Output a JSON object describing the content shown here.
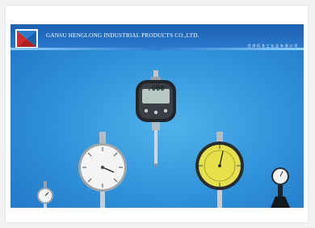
{
  "banner": {
    "company_name": "GANSU HENGLONG INDUSTRIAL PRODUCTS CO.,LTD.",
    "company_name_cn": "甘肃恒龙工业品有限公司"
  },
  "gauges": {
    "digital_reading": ".000"
  },
  "colors": {
    "banner_blue": "#2e8fd8",
    "header_blue": "#1c5fb0",
    "logo_red": "#d62828",
    "dial_yellow": "#e6e04a"
  }
}
